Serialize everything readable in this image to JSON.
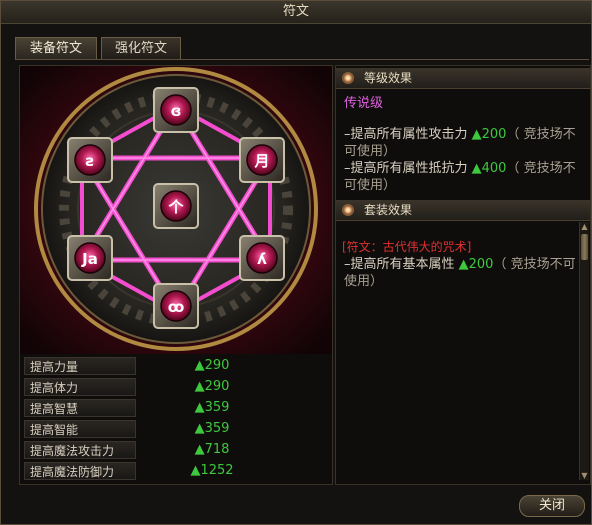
{
  "window": {
    "title": "符文"
  },
  "tabs": [
    {
      "label": "装备符文",
      "active": true
    },
    {
      "label": "强化符文",
      "active": false
    }
  ],
  "runes": [
    {
      "position": "top",
      "glyph": "ɞ"
    },
    {
      "position": "upper-left",
      "glyph": "ƨ"
    },
    {
      "position": "upper-right",
      "glyph": "月"
    },
    {
      "position": "center",
      "glyph": "个"
    },
    {
      "position": "lower-left",
      "glyph": "Ja"
    },
    {
      "position": "lower-right",
      "glyph": "ʎ"
    },
    {
      "position": "bottom",
      "glyph": "ꝏ"
    }
  ],
  "stats": [
    {
      "label": "提高力量",
      "value": "▲290"
    },
    {
      "label": "提高体力",
      "value": "▲290"
    },
    {
      "label": "提高智慧",
      "value": "▲359"
    },
    {
      "label": "提高智能",
      "value": "▲359"
    },
    {
      "label": "提高魔法攻击力",
      "value": "▲718"
    },
    {
      "label": "提高魔法防御力",
      "value": "▲1252"
    }
  ],
  "level_effect": {
    "header": "等级效果",
    "grade": "传说级",
    "lines": [
      {
        "prefix": "–提高所有属性攻击力 ",
        "value": "▲200",
        "note": "（ 竞技场不可使用）"
      },
      {
        "prefix": "–提高所有属性抵抗力 ",
        "value": "▲400",
        "note": "（ 竞技场不可使用）"
      }
    ]
  },
  "set_effect": {
    "header": "套装效果",
    "name": "[符文：古代伟大的咒术]",
    "line": {
      "prefix": "–提高所有基本属性 ",
      "value": "▲200",
      "note": "（ 竞技场不可使用）"
    }
  },
  "buttons": {
    "close": "关闭"
  },
  "colors": {
    "green": "#3ec83e",
    "legendary": "#e060e0",
    "set_name": "#e03030",
    "star": "#ff4fd8"
  }
}
